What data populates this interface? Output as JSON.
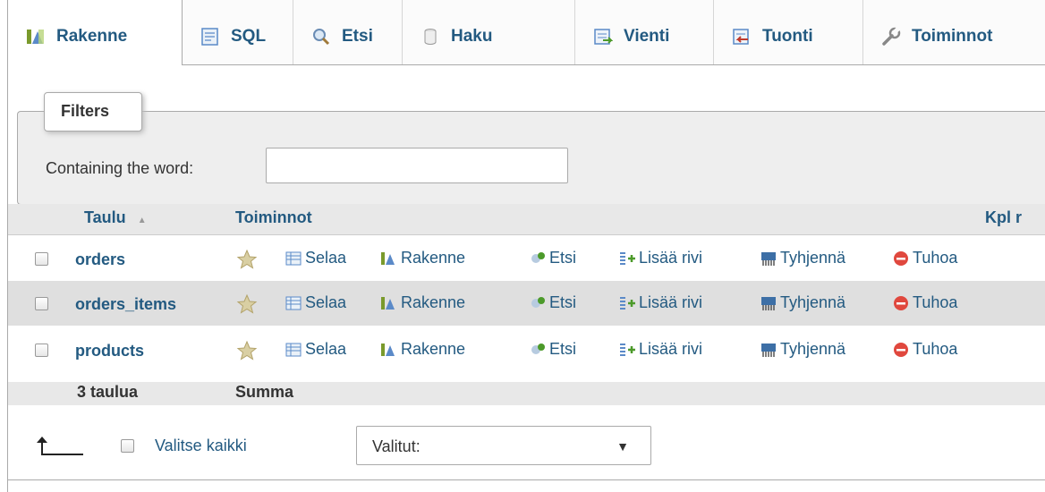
{
  "tabs": [
    {
      "label": "Rakenne",
      "icon": "structure-icon",
      "active": true
    },
    {
      "label": "SQL",
      "icon": "sql-icon"
    },
    {
      "label": "Etsi",
      "icon": "search-icon"
    },
    {
      "label": "Haku",
      "icon": "query-icon"
    },
    {
      "label": "Vienti",
      "icon": "export-icon"
    },
    {
      "label": "Tuonti",
      "icon": "import-icon"
    },
    {
      "label": "Toiminnot",
      "icon": "wrench-icon"
    }
  ],
  "filters": {
    "legend": "Filters",
    "containing_label": "Containing the word:",
    "input_value": "",
    "input_placeholder": ""
  },
  "table": {
    "headers": {
      "taulu": "Taulu",
      "toiminnot": "Toiminnot",
      "kpl": "Kpl r"
    },
    "action_labels": {
      "selaa": "Selaa",
      "rakenne": "Rakenne",
      "etsi": "Etsi",
      "lisaa": "Lisää rivi",
      "tyhjenna": "Tyhjennä",
      "tuhoa": "Tuhoa"
    },
    "rows": [
      {
        "name": "orders"
      },
      {
        "name": "orders_items"
      },
      {
        "name": "products"
      }
    ],
    "footer": {
      "count": "3 taulua",
      "sum": "Summa"
    }
  },
  "bottom": {
    "select_all_label": "Valitse kaikki",
    "with_selected": "Valitut:"
  },
  "colors": {
    "link": "#235a81",
    "header_bg": "#e8e8e8",
    "alt_row": "#dfdfdf",
    "filters_bg": "#eeeeee"
  }
}
